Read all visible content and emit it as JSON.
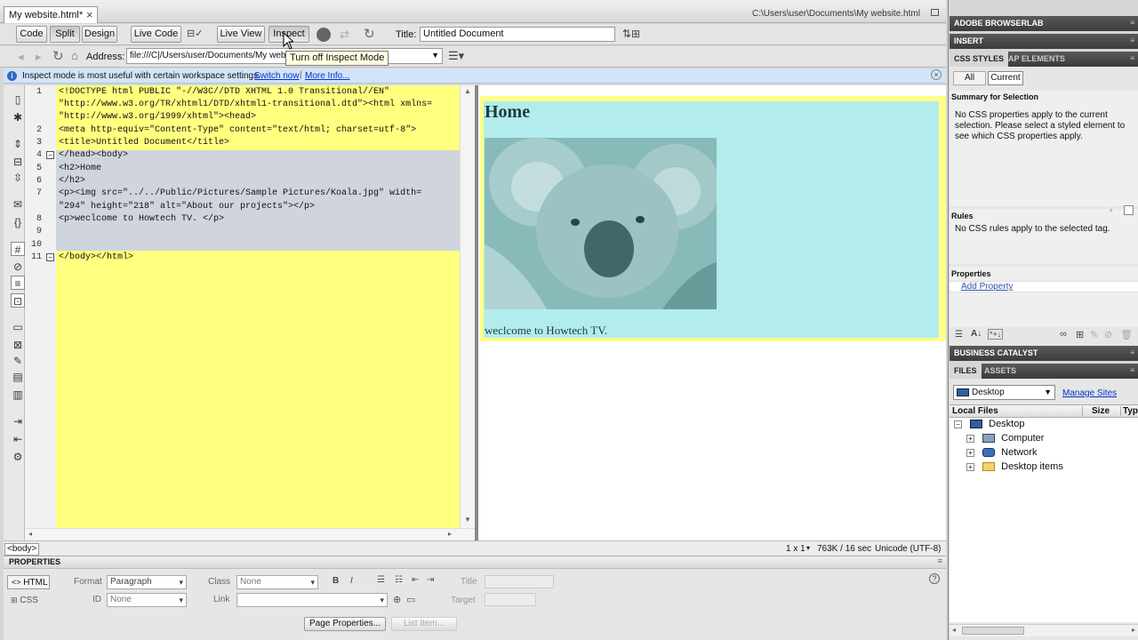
{
  "document_tab": {
    "label": "My website.html*",
    "close": "×"
  },
  "file_path": "C:\\Users\\user\\Documents\\My website.html",
  "view_buttons": {
    "code": "Code",
    "split": "Split",
    "design": "Design",
    "live_code": "Live Code",
    "live_view": "Live View",
    "inspect": "Inspect"
  },
  "title_field": {
    "label": "Title:",
    "value": "Untitled Document"
  },
  "address_bar": {
    "label": "Address:",
    "value": "file:///C|/Users/user/Documents/My webs"
  },
  "tooltip": "Turn off Inspect Mode",
  "info_bar": {
    "text": "Inspect mode is most useful with certain workspace settings.",
    "switch_link": "Switch now",
    "more_link": "More Info..."
  },
  "code_lines": [
    {
      "num": "1",
      "text": "<!DOCTYPE html PUBLIC \"-//W3C//DTD XHTML 1.0 Transitional//EN\""
    },
    {
      "num": "",
      "text": "\"http://www.w3.org/TR/xhtml1/DTD/xhtml1-transitional.dtd\"><html xmlns="
    },
    {
      "num": "",
      "text": "\"http://www.w3.org/1999/xhtml\"><head>"
    },
    {
      "num": "2",
      "text": "<meta http-equiv=\"Content-Type\" content=\"text/html; charset=utf-8\">"
    },
    {
      "num": "3",
      "text": "<title>Untitled Document</title>"
    },
    {
      "num": "4",
      "text": "</head><body>"
    },
    {
      "num": "5",
      "text": "<h2>Home"
    },
    {
      "num": "6",
      "text": "</h2>"
    },
    {
      "num": "7",
      "text": "<p><img src=\"../../Public/Pictures/Sample Pictures/Koala.jpg\" width="
    },
    {
      "num": "",
      "text": "\"294\" height=\"218\" alt=\"About our projects\"></p>"
    },
    {
      "num": "8",
      "text": "<p>weclcome to Howtech TV. </p>"
    },
    {
      "num": "9",
      "text": ""
    },
    {
      "num": "10",
      "text": ""
    },
    {
      "num": "11",
      "text": "</body></html>"
    }
  ],
  "design_view": {
    "heading": "Home",
    "paragraph": "weclcome to Howtech TV."
  },
  "status_bar": {
    "tag": "<body>",
    "zoom": "1 x 1",
    "size": "763K / 16 sec",
    "encoding": "Unicode (UTF-8)"
  },
  "right_panels": {
    "browserlab": "ADOBE BROWSERLAB",
    "insert": "INSERT",
    "css_tabs": [
      "CSS STYLES",
      "AP ELEMENTS"
    ],
    "css_mode": [
      "All",
      "Current"
    ],
    "summary_title": "Summary for Selection",
    "summary_text": "No CSS properties apply to the current selection.  Please select a styled element to see which CSS properties apply.",
    "rules_title": "Rules",
    "rules_text": "No CSS rules apply to the selected tag.",
    "properties_title": "Properties",
    "add_property": "Add Property",
    "business_catalyst": "BUSINESS CATALYST",
    "files_tabs": [
      "FILES",
      "ASSETS"
    ],
    "site_select": "Desktop",
    "manage_sites": "Manage Sites",
    "files_columns": [
      "Local Files",
      "Size",
      "Typ"
    ],
    "tree": [
      "Desktop",
      "Computer",
      "Network",
      "Desktop items"
    ]
  },
  "properties_panel": {
    "title": "PROPERTIES",
    "html_btn": "HTML",
    "css_btn": "CSS",
    "format_label": "Format",
    "format_value": "Paragraph",
    "class_label": "Class",
    "class_value": "None",
    "id_label": "ID",
    "id_value": "None",
    "link_label": "Link",
    "title_label": "Title",
    "target_label": "Target",
    "bold": "B",
    "italic": "I",
    "page_properties": "Page Properties...",
    "list_item": "List Item..."
  }
}
